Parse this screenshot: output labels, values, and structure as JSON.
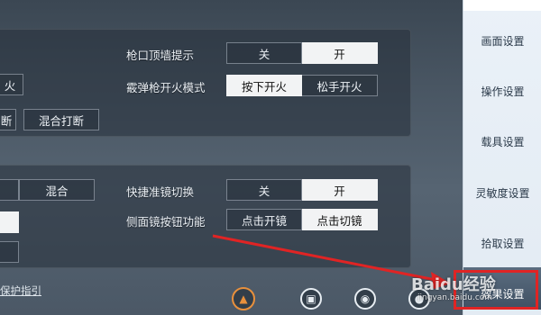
{
  "rows": {
    "wall_hint": {
      "label": "枪口顶墙提示",
      "options": [
        "关",
        "开"
      ],
      "selected": 1
    },
    "shotgun_fire_mode": {
      "label": "霰弹枪开火模式",
      "options": [
        "按下开火",
        "松手开火"
      ],
      "selected": 0
    },
    "scope_switch": {
      "label": "快捷准镜切换",
      "options": [
        "关",
        "开"
      ],
      "selected": 1
    },
    "side_scope_button": {
      "label": "侧面镜按钮功能",
      "options": [
        "点击开镜",
        "点击切镜"
      ],
      "selected": 1
    }
  },
  "left_edge": {
    "fire_partial": "火",
    "interrupt_partial": "断",
    "mixed_interrupt": "混合打断",
    "mixed": "混合"
  },
  "guide_link": "保护指引",
  "sidebar": {
    "items": [
      "画面设置",
      "操作设置",
      "载具设置",
      "灵敏度设置",
      "拾取设置",
      "效果设置"
    ],
    "active_index": 5
  },
  "watermark": {
    "main": "Baidu经验",
    "sub": "jingyan.baidu.com"
  },
  "colors": {
    "annotation": "#e02424",
    "warning_icon": "#e8903c"
  }
}
